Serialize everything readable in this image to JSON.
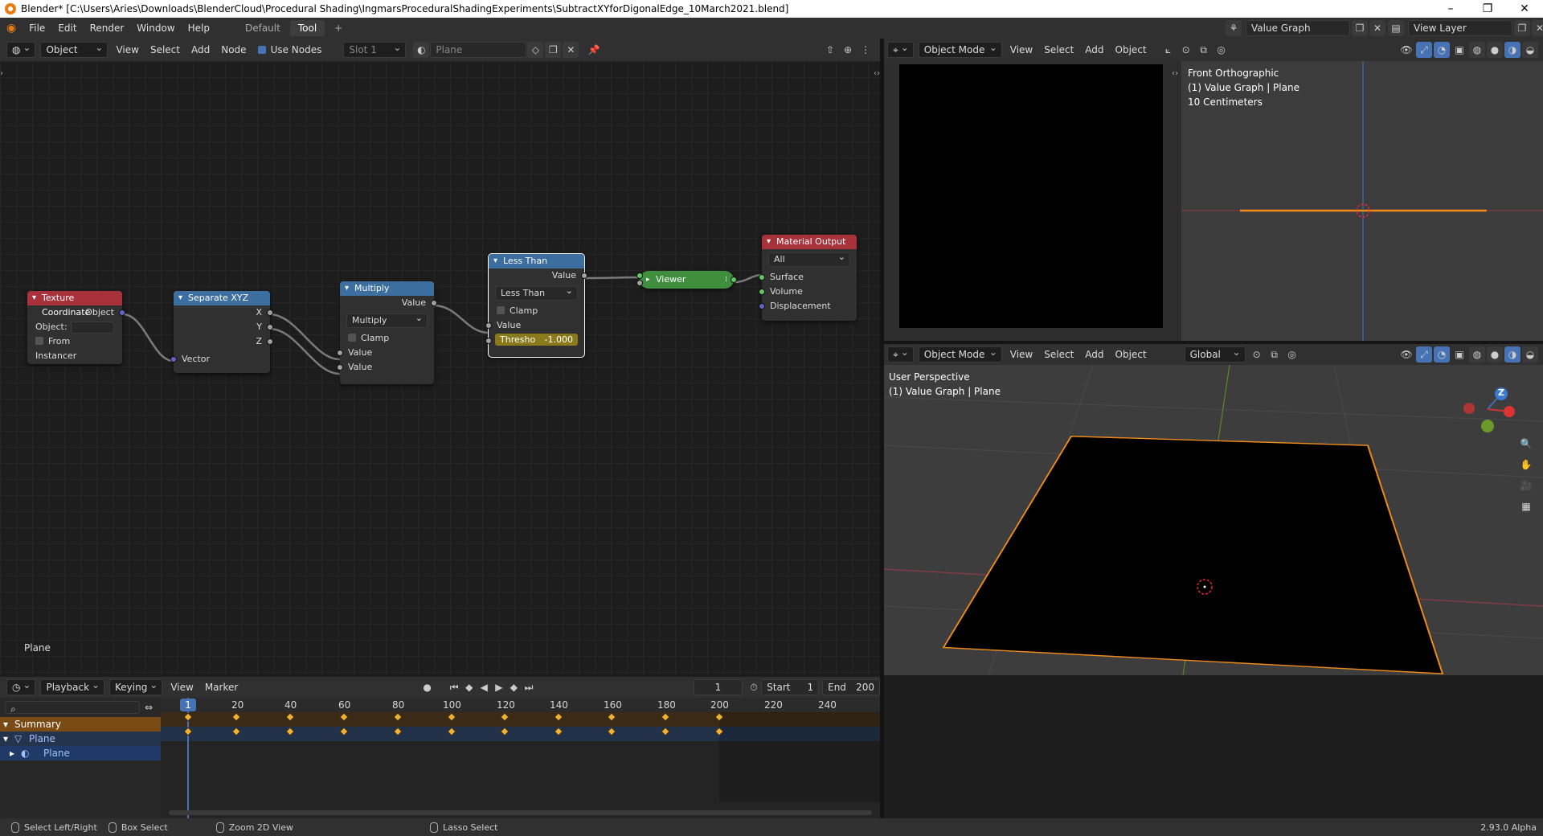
{
  "window": {
    "title": "Blender* [C:\\Users\\Aries\\Downloads\\BlenderCloud\\Procedural Shading\\IngmarsProceduralShadingExperiments\\SubtractXYforDigonalEdge_10March2021.blend]",
    "minimize": "–",
    "maximize": "❐",
    "close": "✕"
  },
  "topmenu": {
    "items": [
      "File",
      "Edit",
      "Render",
      "Window",
      "Help"
    ],
    "workspaces": [
      "Default",
      "Tool"
    ],
    "add_tab": "+",
    "scene": "Value Graph",
    "view_layer": "View Layer"
  },
  "node_header": {
    "mode": "Object",
    "menus": [
      "View",
      "Select",
      "Add",
      "Node"
    ],
    "use_nodes": "Use Nodes",
    "slot": "Slot 1",
    "material": "Plane"
  },
  "nodes": {
    "texcoord": {
      "title": "Texture Coordinate",
      "out": "Object",
      "object_label": "Object:",
      "from_instancer": "From Instancer"
    },
    "sepxyz": {
      "title": "Separate XYZ",
      "x": "X",
      "y": "Y",
      "z": "Z",
      "in": "Vector"
    },
    "multiply": {
      "title": "Multiply",
      "out": "Value",
      "op": "Multiply",
      "clamp": "Clamp",
      "in1": "Value",
      "in2": "Value"
    },
    "lessthan": {
      "title": "Less Than",
      "out": "Value",
      "op": "Less Than",
      "clamp": "Clamp",
      "in": "Value",
      "thresh_label": "Thresho",
      "thresh_value": "-1.000"
    },
    "viewer": {
      "title": "Viewer"
    },
    "matout": {
      "title": "Material Output",
      "target": "All",
      "surface": "Surface",
      "volume": "Volume",
      "displacement": "Displacement"
    }
  },
  "node_editor": {
    "object_name": "Plane"
  },
  "viewport_header": {
    "mode": "Object Mode",
    "menus": [
      "View",
      "Select",
      "Add",
      "Object"
    ],
    "orientation": "Global"
  },
  "front_ortho": {
    "line1": "Front Orthographic",
    "line2": "(1) Value Graph | Plane",
    "line3": "10 Centimeters"
  },
  "perspective": {
    "line1": "User Perspective",
    "line2": "(1) Value Graph | Plane",
    "gizmo_z": "Z"
  },
  "timeline_header": {
    "menus": [
      "Playback",
      "Keying",
      "View",
      "Marker"
    ],
    "current_frame": "1",
    "start_label": "Start",
    "start": "1",
    "end_label": "End",
    "end": "200"
  },
  "timeline": {
    "ticks": [
      "1",
      "20",
      "40",
      "60",
      "80",
      "100",
      "120",
      "140",
      "160",
      "180",
      "200",
      "220",
      "240"
    ],
    "channels": [
      "Summary",
      "Plane",
      "Plane"
    ]
  },
  "status": {
    "items": [
      "Select Left/Right",
      "Box Select",
      "Zoom 2D View",
      "Lasso Select"
    ],
    "version": "2.93.0 Alpha"
  },
  "colors": {
    "texcoord_head": "#a7323c",
    "sepxyz_head": "#3c6fa0",
    "math_head": "#3c6fa0",
    "matout_head": "#a7323c",
    "viewer": "#3f8f3f",
    "selection": "#f08a1b",
    "keyframe": "#f0b030"
  }
}
